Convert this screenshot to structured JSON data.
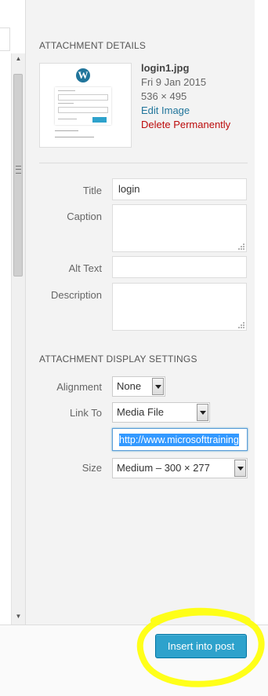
{
  "attachment_details": {
    "heading": "ATTACHMENT DETAILS",
    "file_name": "login1.jpg",
    "date": "Fri 9 Jan 2015",
    "dimensions": "536 × 495",
    "edit_image": "Edit Image",
    "delete_permanently": "Delete Permanently"
  },
  "fields": {
    "title_label": "Title",
    "title_value": "login",
    "caption_label": "Caption",
    "caption_value": "",
    "alt_label": "Alt Text",
    "alt_value": "",
    "description_label": "Description",
    "description_value": ""
  },
  "display_settings": {
    "heading": "ATTACHMENT DISPLAY SETTINGS",
    "alignment_label": "Alignment",
    "alignment_value": "None",
    "link_to_label": "Link To",
    "link_to_value": "Media File",
    "link_url": "http://www.microsofttraining",
    "size_label": "Size",
    "size_value": "Medium – 300 × 277"
  },
  "footer": {
    "insert_button": "Insert into post"
  },
  "colors": {
    "primary_button": "#2ea2cc",
    "link": "#21759b",
    "delete": "#bc0b0b",
    "highlight_annotation": "#ffff00"
  },
  "icons": {
    "thumbnail_logo": "wordpress-logo-icon",
    "scroll_up": "scroll-up-arrow-icon",
    "scroll_down": "scroll-down-arrow-icon",
    "dropdown": "chevron-down-icon",
    "resize": "resize-grip-icon"
  }
}
